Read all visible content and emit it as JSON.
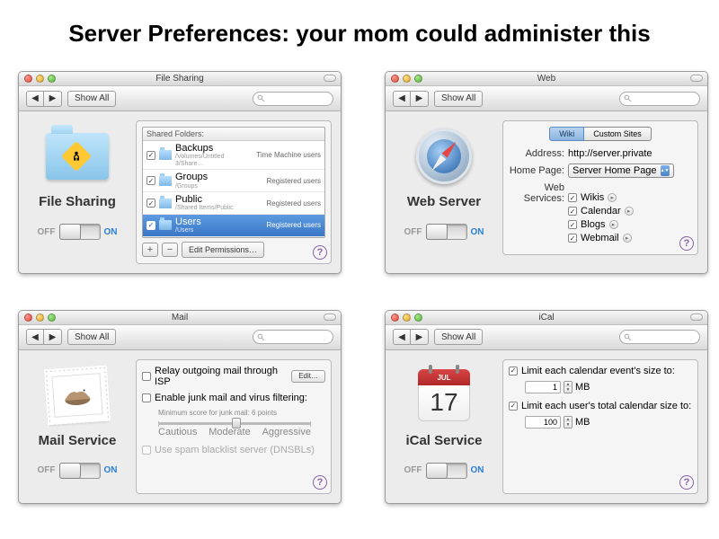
{
  "title": "Server Preferences: your mom could administer this",
  "common": {
    "show_all": "Show All",
    "off": "OFF",
    "on": "ON",
    "help": "?",
    "back": "◀",
    "forward": "▶"
  },
  "file_sharing": {
    "window_title": "File Sharing",
    "service_name": "File Sharing",
    "shared_folders_label": "Shared Folders:",
    "folders": [
      {
        "checked": true,
        "name": "Backups",
        "path": "/Volumes/Untitled 3/Share…",
        "perm": "Time Machine users",
        "selected": false
      },
      {
        "checked": true,
        "name": "Groups",
        "path": "/Groups",
        "perm": "Registered users",
        "selected": false
      },
      {
        "checked": true,
        "name": "Public",
        "path": "/Shared Items/Public",
        "perm": "Registered users",
        "selected": false
      },
      {
        "checked": true,
        "name": "Users",
        "path": "/Users",
        "perm": "Registered users",
        "selected": true
      }
    ],
    "add": "+",
    "remove": "−",
    "edit_perms": "Edit Permissions…"
  },
  "web": {
    "window_title": "Web",
    "service_name": "Web Server",
    "tab_wiki": "Wiki",
    "tab_custom": "Custom Sites",
    "address_label": "Address:",
    "address_value": "http://server.private",
    "home_page_label": "Home Page:",
    "home_page_value": "Server Home Page",
    "services_label": "Web Services:",
    "services": [
      {
        "name": "Wikis",
        "checked": true
      },
      {
        "name": "Calendar",
        "checked": true
      },
      {
        "name": "Blogs",
        "checked": true
      },
      {
        "name": "Webmail",
        "checked": true
      }
    ]
  },
  "mail": {
    "window_title": "Mail",
    "service_name": "Mail Service",
    "relay": "Relay outgoing mail through ISP",
    "edit": "Edit…",
    "junk": "Enable junk mail and virus filtering:",
    "junk_score": "Minimum score for junk mail:  6 points",
    "cautious": "Cautious",
    "moderate": "Moderate",
    "aggressive": "Aggressive",
    "spam": "Use spam blacklist server (DNSBLs)"
  },
  "ical": {
    "window_title": "iCal",
    "service_name": "iCal Service",
    "month": "JUL",
    "day": "17",
    "limit_event": "Limit each calendar event's size to:",
    "limit_event_val": "1",
    "limit_total": "Limit each user's total calendar size to:",
    "limit_total_val": "100",
    "mb": "MB"
  }
}
